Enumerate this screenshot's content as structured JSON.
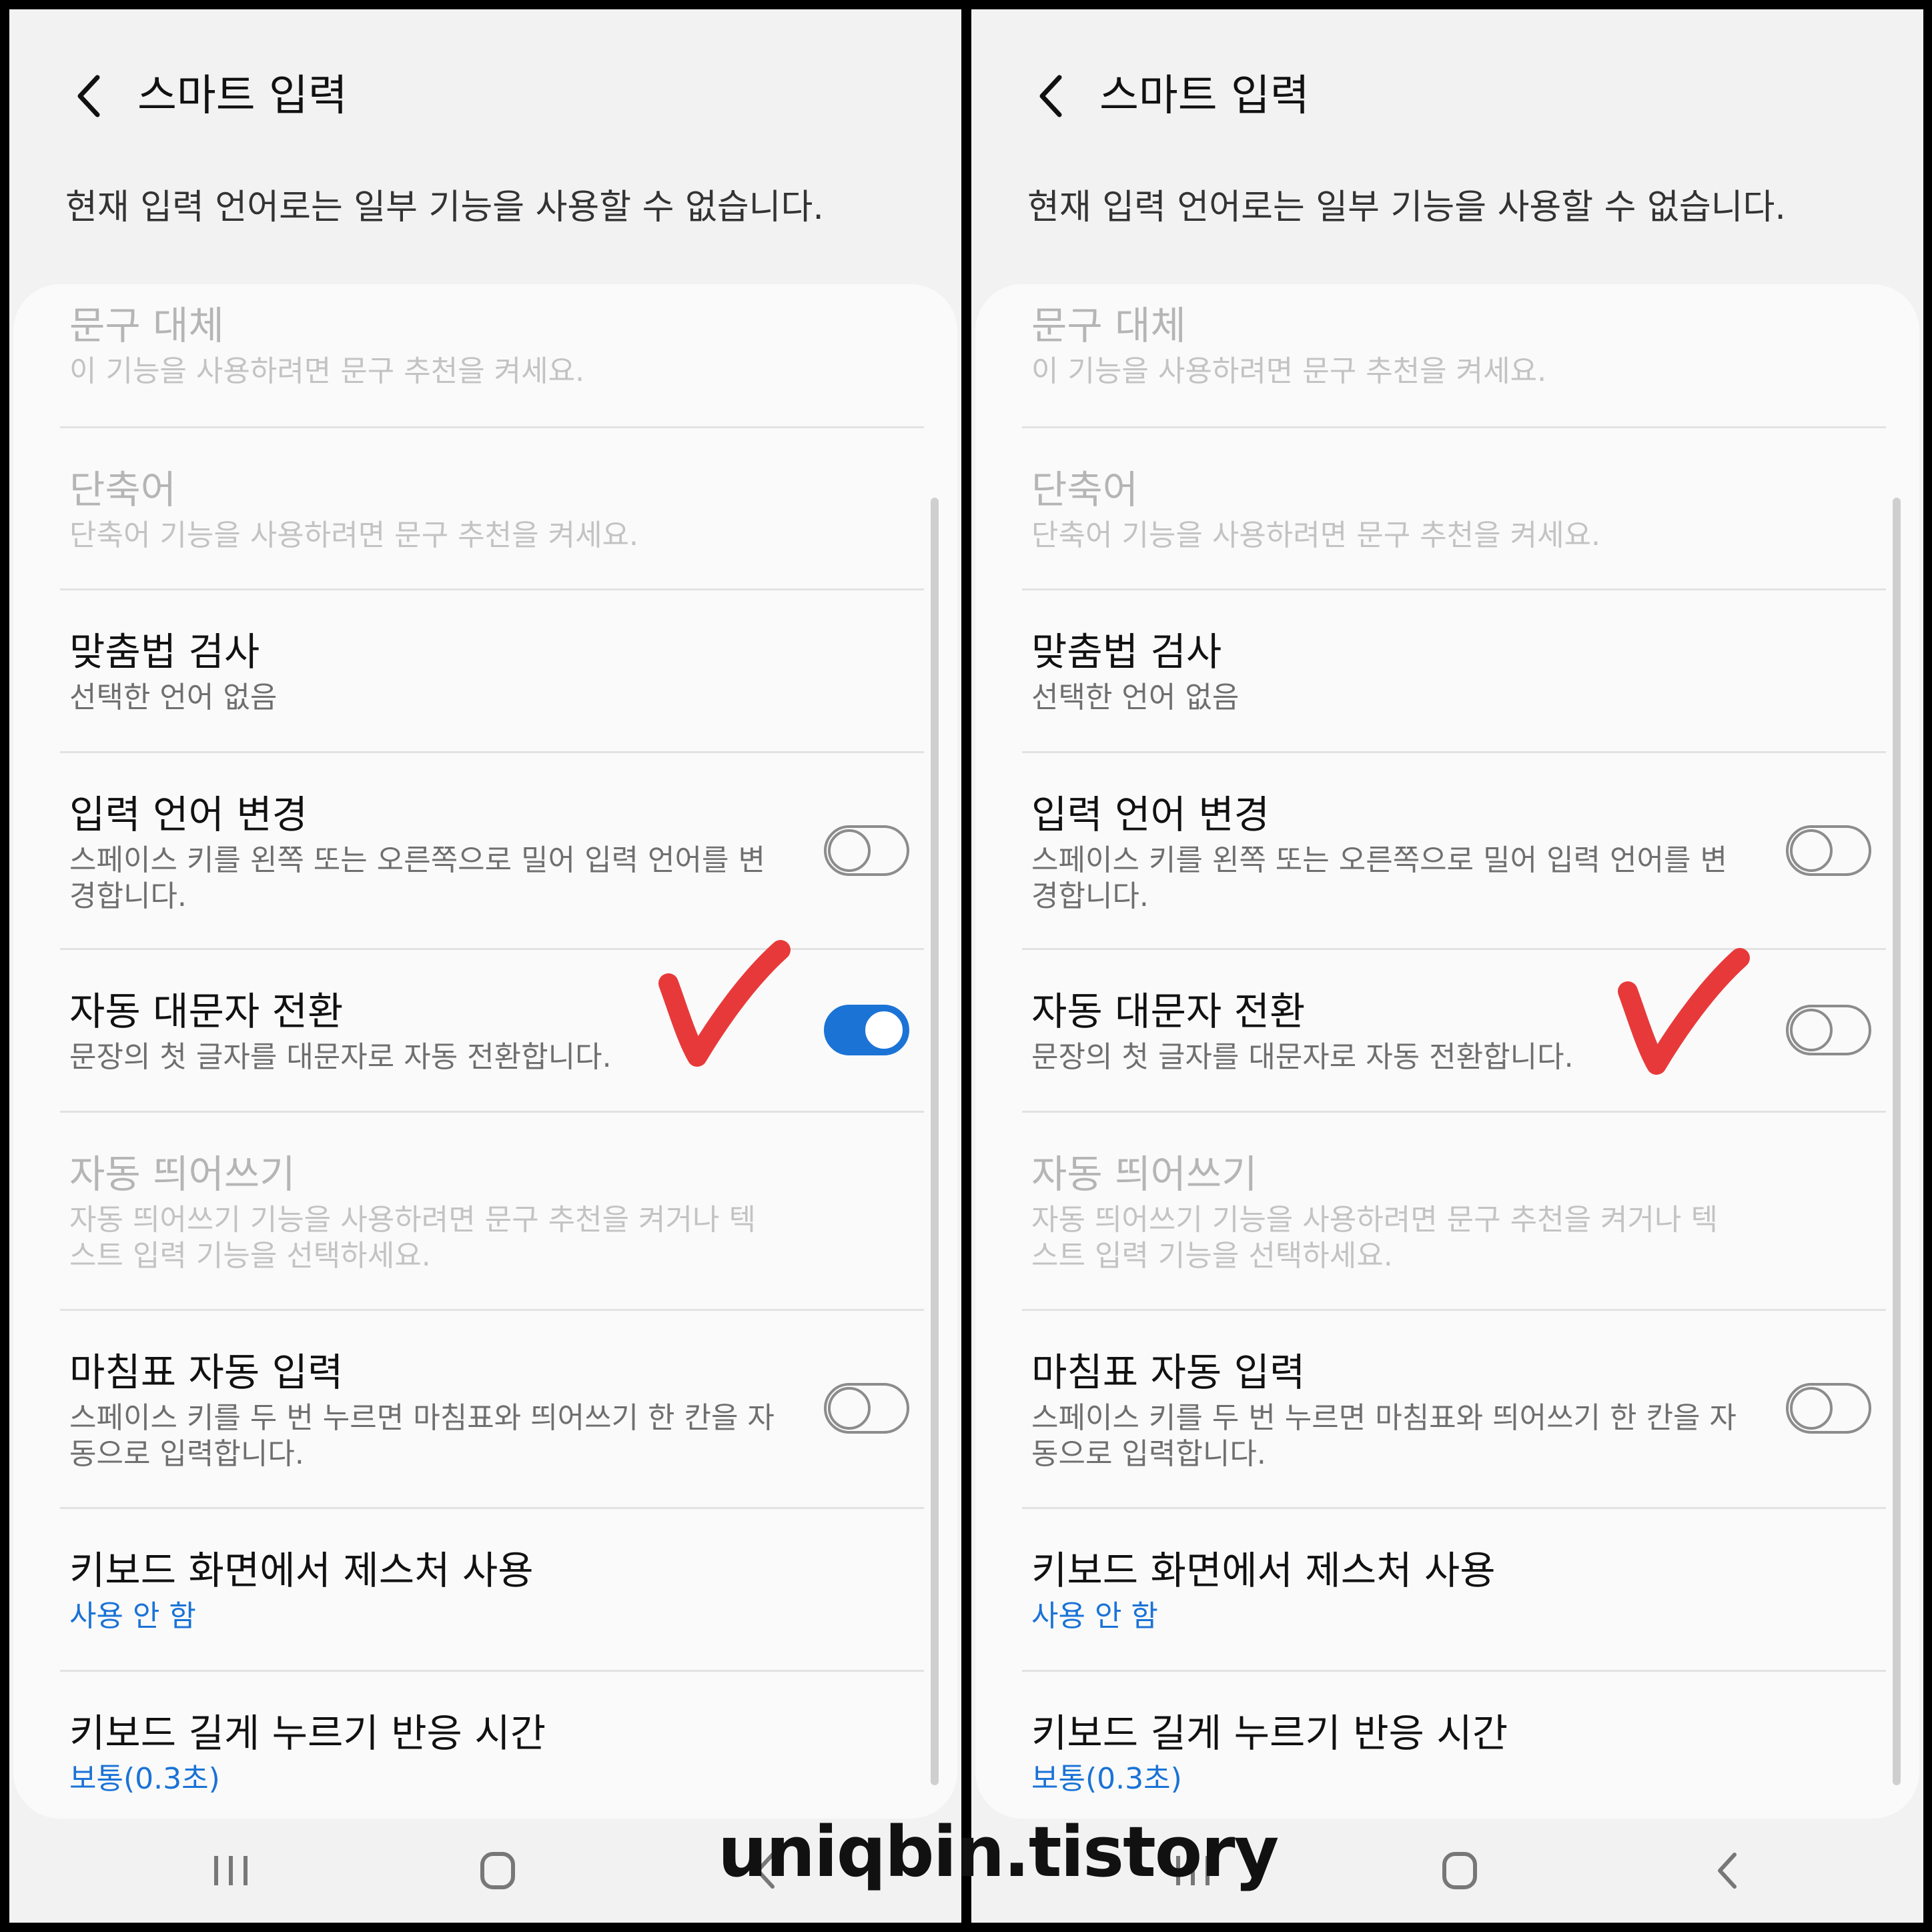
{
  "colors": {
    "accent": "#1b73d6",
    "link_blue": "#1a73d6",
    "check_red": "#e8393a",
    "background": "#f2f2f2",
    "card": "#fafafa"
  },
  "screen": {
    "title": "스마트 입력",
    "back_icon": "chevron-left-icon",
    "notice": "현재 입력 언어로는 일부 기능을 사용할 수 없습니다."
  },
  "items": [
    {
      "title": "문구 대체",
      "sub": "이 기능을 사용하려면 문구 추천을 켜세요.",
      "enabled": false
    },
    {
      "title": "단축어",
      "sub": "단축어 기능을 사용하려면 문구 추천을 켜세요.",
      "enabled": false
    },
    {
      "title": "맞춤법 검사",
      "sub": "선택한 언어 없음",
      "enabled": true
    },
    {
      "title": "입력 언어 변경",
      "sub": "스페이스 키를 왼쪽 또는 오른쪽으로 밀어 입력 언어를 변경합니다.",
      "enabled": true,
      "toggle": false
    },
    {
      "title": "자동 대문자 전환",
      "sub": "문장의 첫 글자를 대문자로 자동 전환합니다.",
      "enabled": true
    },
    {
      "title": "자동 띄어쓰기",
      "sub": "자동 띄어쓰기 기능을 사용하려면 문구 추천을 켜거나 텍스트 입력 기능을 선택하세요.",
      "enabled": false
    },
    {
      "title": "마침표 자동 입력",
      "sub": "스페이스 키를 두 번 누르면 마침표와 띄어쓰기 한 칸을 자동으로 입력합니다.",
      "enabled": true,
      "toggle": false
    },
    {
      "title": "키보드 화면에서 제스처 사용",
      "sub": "사용 안 함",
      "enabled": true
    },
    {
      "title": "키보드 길게 누르기 반응 시간",
      "sub": "보통(0.3초)",
      "enabled": true
    }
  ],
  "panels": [
    {
      "id": "left",
      "auto_capitalization_toggle": true
    },
    {
      "id": "right",
      "auto_capitalization_toggle": false
    }
  ],
  "navbar": {
    "recent_icon": "recent-apps-icon",
    "home_icon": "home-icon",
    "back_icon": "back-icon"
  },
  "watermark": "uniqbin.tistory"
}
